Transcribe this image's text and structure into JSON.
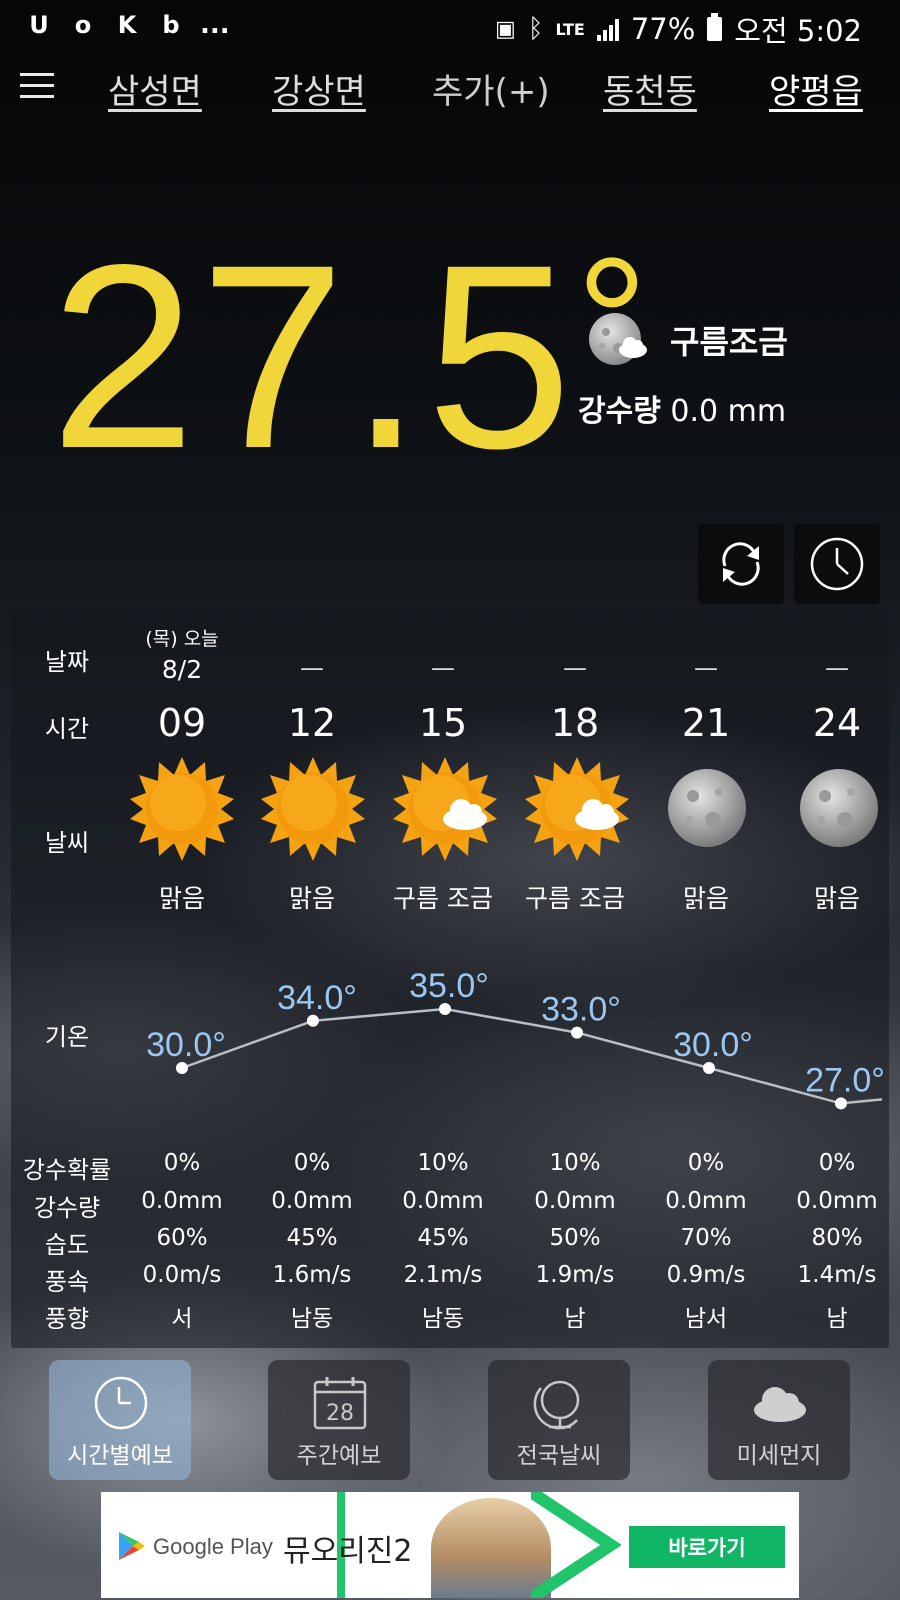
{
  "status_bar": {
    "left_icons": [
      "U",
      "o",
      "K",
      "b"
    ],
    "more": "...",
    "network": "LTE",
    "battery": "77%",
    "time": "오전 5:02"
  },
  "tabs": [
    {
      "label": "삼성면"
    },
    {
      "label": "강상면"
    },
    {
      "label": "추가(+)"
    },
    {
      "label": "동천동"
    },
    {
      "label": "양평읍"
    }
  ],
  "current": {
    "temp_int": "27",
    "temp_dot": ".",
    "temp_dec": "5",
    "degree": "°",
    "condition": "구름조금",
    "precip_label": "강수량",
    "precip_value": "0.0 mm"
  },
  "table": {
    "labels": {
      "date": "날짜",
      "time": "시간",
      "weather": "날씨",
      "temp": "기온",
      "rain_prob": "강수확률",
      "rain_amount": "강수량",
      "humidity": "습도",
      "wind_speed": "풍속",
      "wind_dir": "풍향"
    },
    "columns": [
      {
        "date_top": "(목) 오늘",
        "date": "8/2",
        "hour": "09",
        "icon": "sun-icon",
        "weather": "맑음",
        "temp": "30.0°",
        "prob": "0%",
        "amount": "0.0mm",
        "humidity": "60%",
        "wind": "0.0m/s",
        "dir": "서"
      },
      {
        "date_top": "",
        "date": "—",
        "hour": "12",
        "icon": "sun-icon",
        "weather": "맑음",
        "temp": "34.0°",
        "prob": "0%",
        "amount": "0.0mm",
        "humidity": "45%",
        "wind": "1.6m/s",
        "dir": "남동"
      },
      {
        "date_top": "",
        "date": "—",
        "hour": "15",
        "icon": "sun-cloud-icon",
        "weather": "구름 조금",
        "temp": "35.0°",
        "prob": "10%",
        "amount": "0.0mm",
        "humidity": "45%",
        "wind": "2.1m/s",
        "dir": "남동"
      },
      {
        "date_top": "",
        "date": "—",
        "hour": "18",
        "icon": "sun-cloud-icon",
        "weather": "구름 조금",
        "temp": "33.0°",
        "prob": "10%",
        "amount": "0.0mm",
        "humidity": "50%",
        "wind": "1.9m/s",
        "dir": "남"
      },
      {
        "date_top": "",
        "date": "—",
        "hour": "21",
        "icon": "moon-icon",
        "weather": "맑음",
        "temp": "30.0°",
        "prob": "0%",
        "amount": "0.0mm",
        "humidity": "70%",
        "wind": "0.9m/s",
        "dir": "남서"
      },
      {
        "date_top": "",
        "date": "—",
        "hour": "24",
        "icon": "moon-icon",
        "weather": "맑음",
        "temp": "27.0°",
        "prob": "0%",
        "amount": "0.0mm",
        "humidity": "80%",
        "wind": "1.4m/s",
        "dir": "남"
      }
    ]
  },
  "chart_data": {
    "type": "line",
    "categories": [
      "09",
      "12",
      "15",
      "18",
      "21",
      "24"
    ],
    "series": [
      {
        "values": [
          30.0,
          34.0,
          35.0,
          33.0,
          30.0,
          27.0
        ]
      }
    ]
  },
  "bottom_nav": [
    {
      "label": "시간별예보",
      "icon": "clock-icon",
      "active": true
    },
    {
      "label": "주간예보",
      "icon": "calendar-icon",
      "calendar_day": "28",
      "active": false
    },
    {
      "label": "전국날씨",
      "icon": "globe-icon",
      "active": false
    },
    {
      "label": "미세먼지",
      "icon": "cloud-icon",
      "active": false
    }
  ],
  "ad": {
    "store": "Google Play",
    "title": "뮤오리진2",
    "button": "바로가기"
  },
  "colors": {
    "temp_yellow": "#f1d63a",
    "chart_blue": "#9bc7f2",
    "ad_green": "#11b566"
  }
}
